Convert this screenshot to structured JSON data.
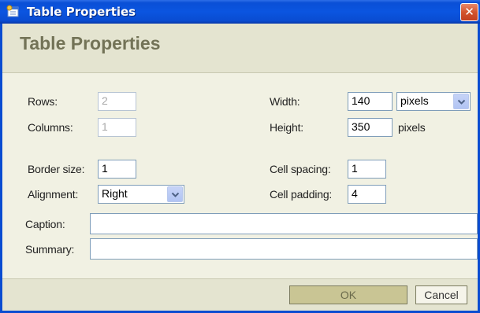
{
  "window": {
    "title": "Table Properties",
    "close_symbol": "✕"
  },
  "header": {
    "title": "Table Properties"
  },
  "form": {
    "rows_label": "Rows:",
    "rows_value": "2",
    "columns_label": "Columns:",
    "columns_value": "1",
    "width_label": "Width:",
    "width_value": "140",
    "width_unit_selected": "pixels",
    "height_label": "Height:",
    "height_value": "350",
    "height_unit": "pixels",
    "border_label": "Border size:",
    "border_value": "1",
    "alignment_label": "Alignment:",
    "alignment_selected": "Right",
    "cell_spacing_label": "Cell spacing:",
    "cell_spacing_value": "1",
    "cell_padding_label": "Cell padding:",
    "cell_padding_value": "4",
    "caption_label": "Caption:",
    "caption_value": "",
    "summary_label": "Summary:",
    "summary_value": ""
  },
  "buttons": {
    "ok_label": "OK",
    "cancel_label": "Cancel"
  },
  "colors": {
    "titlebar": "#0a4fd6",
    "dialog_bg": "#f1f1e3",
    "header_bg": "#e4e4d0",
    "header_text": "#737357",
    "close_button": "#d3542e"
  },
  "icons": {
    "app": "window-app-icon",
    "close": "close-icon",
    "dropdown": "chevron-down-icon"
  }
}
